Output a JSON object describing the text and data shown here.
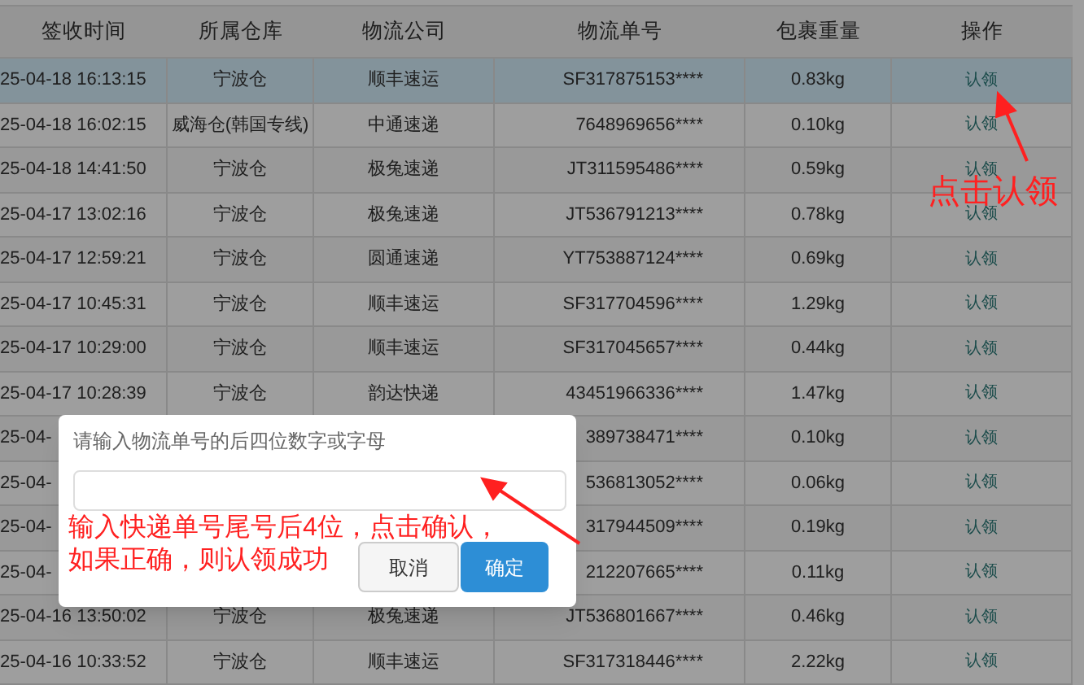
{
  "table": {
    "columns": [
      "签收时间",
      "所属仓库",
      "物流公司",
      "物流单号",
      "包裹重量",
      "操作"
    ],
    "rows": [
      {
        "time": "25-04-18 16:13:15",
        "warehouse": "宁波仓",
        "carrier": "顺丰速运",
        "tracking": "SF317875153****",
        "weight": "0.83kg",
        "action": "认领",
        "selected": true
      },
      {
        "time": "25-04-18 16:02:15",
        "warehouse": "威海仓(韩国专线)",
        "carrier": "中通速递",
        "tracking": "7648969656****",
        "weight": "0.10kg",
        "action": "认领",
        "selected": false
      },
      {
        "time": "25-04-18 14:41:50",
        "warehouse": "宁波仓",
        "carrier": "极兔速递",
        "tracking": "JT311595486****",
        "weight": "0.59kg",
        "action": "认领",
        "selected": false
      },
      {
        "time": "25-04-17 13:02:16",
        "warehouse": "宁波仓",
        "carrier": "极兔速递",
        "tracking": "JT536791213****",
        "weight": "0.78kg",
        "action": "认领",
        "selected": false
      },
      {
        "time": "25-04-17 12:59:21",
        "warehouse": "宁波仓",
        "carrier": "圆通速递",
        "tracking": "YT753887124****",
        "weight": "0.69kg",
        "action": "认领",
        "selected": false
      },
      {
        "time": "25-04-17 10:45:31",
        "warehouse": "宁波仓",
        "carrier": "顺丰速运",
        "tracking": "SF317704596****",
        "weight": "1.29kg",
        "action": "认领",
        "selected": false
      },
      {
        "time": "25-04-17 10:29:00",
        "warehouse": "宁波仓",
        "carrier": "顺丰速运",
        "tracking": "SF317045657****",
        "weight": "0.44kg",
        "action": "认领",
        "selected": false
      },
      {
        "time": "25-04-17 10:28:39",
        "warehouse": "宁波仓",
        "carrier": "韵达快递",
        "tracking": "43451966336****",
        "weight": "1.47kg",
        "action": "认领",
        "selected": false
      },
      {
        "time": "25-04-",
        "tracking": "389738471****",
        "weight": "0.10kg",
        "action": "认领",
        "selected": false
      },
      {
        "time": "25-04-",
        "tracking": "536813052****",
        "weight": "0.06kg",
        "action": "认领",
        "selected": false
      },
      {
        "time": "25-04-",
        "tracking": "317944509****",
        "weight": "0.19kg",
        "action": "认领",
        "selected": false
      },
      {
        "time": "25-04-",
        "tracking": "212207665****",
        "weight": "0.11kg",
        "action": "认领",
        "selected": false
      },
      {
        "time": "25-04-16 13:50:02",
        "warehouse": "宁波仓",
        "carrier": "极兔速递",
        "tracking": "JT536801667****",
        "weight": "0.46kg",
        "action": "认领",
        "selected": false
      },
      {
        "time": "25-04-16 10:33:52",
        "warehouse": "宁波仓",
        "carrier": "顺丰速运",
        "tracking": "SF317318446****",
        "weight": "2.22kg",
        "action": "认领",
        "selected": false
      }
    ]
  },
  "dialog": {
    "prompt": "请输入物流单号的后四位数字或字母",
    "buttons": [
      {
        "label": "取消",
        "kind": "cancel"
      },
      {
        "label": "确定",
        "kind": "confirm"
      }
    ]
  },
  "annotations": [
    {
      "text": "点击认领",
      "kind": "action"
    },
    {
      "text": "输入快递单号尾号后4位，点击确认，",
      "kind": "dialog"
    },
    {
      "text": "如果正确，则认领成功",
      "kind": "dialog"
    }
  ]
}
